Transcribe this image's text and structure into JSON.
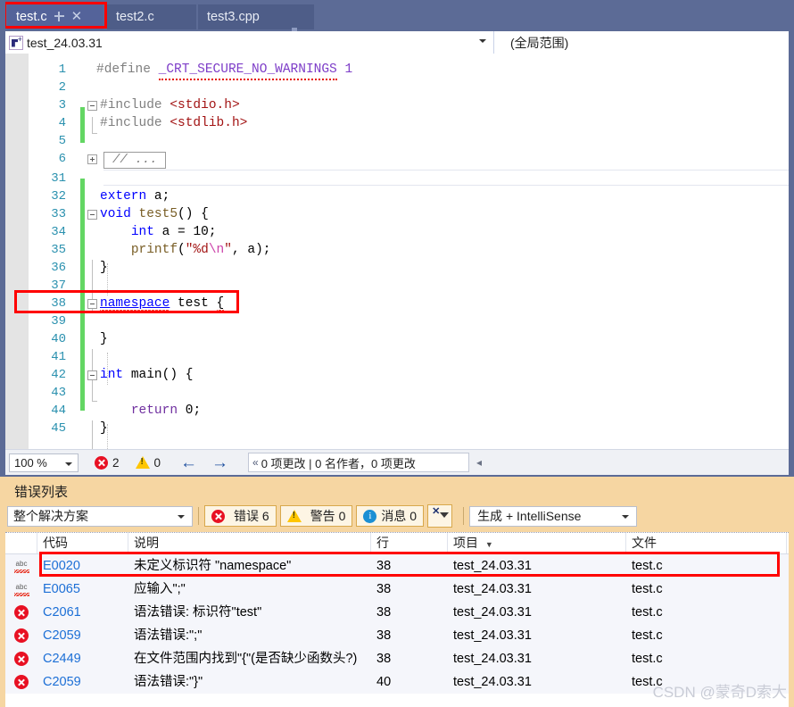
{
  "window": {
    "accent_blue": "#5c6b96",
    "error_red": "#e81123",
    "highlight_red": "#ff0000"
  },
  "tabs": [
    {
      "label": "test.c",
      "active": true,
      "pin_icon": "pin-icon",
      "close_icon": "close-icon"
    },
    {
      "label": "test2.c",
      "active": false
    },
    {
      "label": "test3.cpp",
      "active": false
    }
  ],
  "navbar": {
    "icon": "class-scope-icon",
    "project_scope": "test_24.03.31",
    "member_scope": "(全局范围)",
    "dropdown_icon": "chevron-down-icon"
  },
  "editor": {
    "lines": [
      {
        "num": "1",
        "text": "#define _CRT_SECURE_NO_WARNINGS 1"
      },
      {
        "num": "2",
        "text": ""
      },
      {
        "num": "3",
        "text": "#include <stdio.h>"
      },
      {
        "num": "4",
        "text": "#include <stdlib.h>"
      },
      {
        "num": "5",
        "text": ""
      },
      {
        "num": "6",
        "text": "// ..."
      },
      {
        "num": "31",
        "text": ""
      },
      {
        "num": "32",
        "text": "extern a;"
      },
      {
        "num": "33",
        "text": "void test5() {"
      },
      {
        "num": "34",
        "text": "    int a = 10;"
      },
      {
        "num": "35",
        "text": "    printf(\"%d\\n\", a);"
      },
      {
        "num": "36",
        "text": "}"
      },
      {
        "num": "37",
        "text": ""
      },
      {
        "num": "38",
        "text": "namespace test {"
      },
      {
        "num": "39",
        "text": ""
      },
      {
        "num": "40",
        "text": "}"
      },
      {
        "num": "41",
        "text": ""
      },
      {
        "num": "42",
        "text": "int main() {"
      },
      {
        "num": "43",
        "text": ""
      },
      {
        "num": "44",
        "text": "    return 0;"
      },
      {
        "num": "45",
        "text": "}"
      }
    ],
    "collapsed_placeholder": "// ...",
    "highlighted_line": "38"
  },
  "status_bar": {
    "zoom": "100 %",
    "zoom_dropdown_icon": "chevron-down-icon",
    "error_icon": "error-circle-icon",
    "error_count": "2",
    "warning_icon": "warning-triangle-icon",
    "warning_count": "0",
    "prev_icon": "arrow-left-icon",
    "next_icon": "arrow-right-icon",
    "git_chevron_icon": "chevron-left-icon",
    "git_text": "0 项更改 | 0 名作者，0 项更改",
    "git_overflow_icon": "chevron-left-icon"
  },
  "error_panel": {
    "title": "错误列表",
    "scope_filter": "整个解决方案",
    "scope_caret_icon": "chevron-down-icon",
    "toggles": [
      {
        "icon": "error-circle-icon",
        "label": "错误 6"
      },
      {
        "icon": "warning-triangle-icon",
        "label": "警告 0"
      },
      {
        "icon": "info-circle-icon",
        "label": "消息 0"
      }
    ],
    "clear_filter_icon": "clear-filter-icon",
    "build_filter": "生成 + IntelliSense",
    "build_caret_icon": "chevron-down-icon",
    "columns": [
      "",
      "代码",
      "说明",
      "行",
      "项目",
      "文件"
    ],
    "project_sort_icon": "sort-desc-icon",
    "rows": [
      {
        "icon": "intellisense-squiggle-icon",
        "code": "E0020",
        "description": "未定义标识符 \"namespace\"",
        "line": "38",
        "project": "test_24.03.31",
        "file": "test.c",
        "highlighted": true
      },
      {
        "icon": "intellisense-squiggle-icon",
        "code": "E0065",
        "description": "应输入\";\"",
        "line": "38",
        "project": "test_24.03.31",
        "file": "test.c",
        "highlighted": false
      },
      {
        "icon": "error-circle-icon",
        "code": "C2061",
        "description": "语法错误: 标识符\"test\"",
        "line": "38",
        "project": "test_24.03.31",
        "file": "test.c",
        "highlighted": false
      },
      {
        "icon": "error-circle-icon",
        "code": "C2059",
        "description": "语法错误:\";\"",
        "line": "38",
        "project": "test_24.03.31",
        "file": "test.c",
        "highlighted": false
      },
      {
        "icon": "error-circle-icon",
        "code": "C2449",
        "description": "在文件范围内找到\"{\"(是否缺少函数头?)",
        "line": "38",
        "project": "test_24.03.31",
        "file": "test.c",
        "highlighted": false
      },
      {
        "icon": "error-circle-icon",
        "code": "C2059",
        "description": "语法错误:\"}\"",
        "line": "40",
        "project": "test_24.03.31",
        "file": "test.c",
        "highlighted": false
      }
    ]
  },
  "watermark": "CSDN @蒙奇D索大"
}
